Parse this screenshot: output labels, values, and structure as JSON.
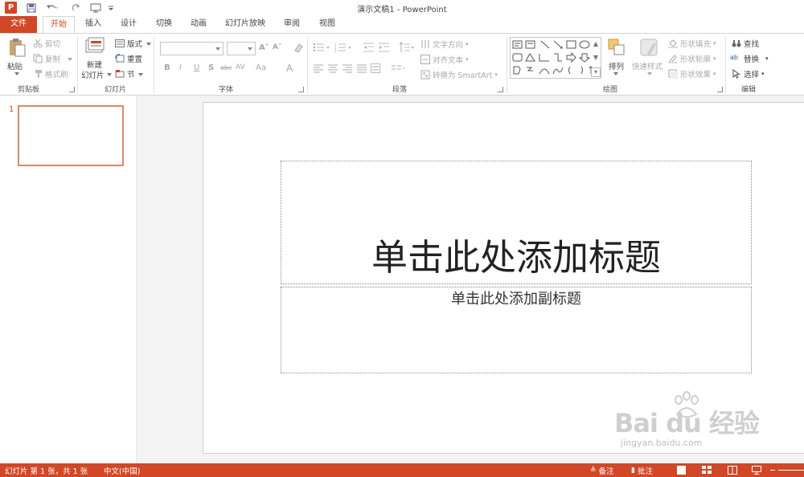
{
  "window": {
    "title": "演示文稿1 - PowerPoint",
    "app_icon_letter": "P"
  },
  "quick_access": {
    "save_icon": "save-icon",
    "undo_icon": "undo-icon",
    "redo_icon": "redo-icon",
    "present_icon": "start-from-beginning-icon",
    "customize_icon": "customize-toolbar-icon"
  },
  "tabs": [
    {
      "label": "文件"
    },
    {
      "label": "开始"
    },
    {
      "label": "插入"
    },
    {
      "label": "设计"
    },
    {
      "label": "切换"
    },
    {
      "label": "动画"
    },
    {
      "label": "幻灯片放映"
    },
    {
      "label": "审阅"
    },
    {
      "label": "视图"
    }
  ],
  "ribbon": {
    "clipboard": {
      "paste": "粘贴",
      "cut": "剪切",
      "copy": "复制",
      "format_painter": "格式刷",
      "group_label": "剪贴板"
    },
    "slides": {
      "new_slide_line1": "新建",
      "new_slide_line2": "幻灯片",
      "layout": "版式",
      "reset": "重置",
      "section": "节",
      "group_label": "幻灯片"
    },
    "font": {
      "font_name_value": "",
      "font_size_value": "",
      "grow": "A˄",
      "shrink": "A˅",
      "clear": "清除格式",
      "bold": "B",
      "italic": "I",
      "underline": "U",
      "shadow": "S",
      "strike": "abc",
      "spacing": "AV",
      "case": "Aa",
      "color": "A",
      "group_label": "字体"
    },
    "paragraph": {
      "text_direction": "文字方向",
      "align_text": "对齐文本",
      "convert_smartart": "转换为 SmartArt",
      "group_label": "段落"
    },
    "drawing": {
      "arrange": "排列",
      "quick_styles": "快速样式",
      "shape_fill": "形状填充",
      "shape_outline": "形状轮廓",
      "shape_effects": "形状效果",
      "group_label": "绘图"
    },
    "editing": {
      "find": "查找",
      "replace": "替换",
      "select": "选择",
      "group_label": "编辑"
    }
  },
  "thumbnail_pane": {
    "slide_number": "1"
  },
  "slide": {
    "title_placeholder": "单击此处添加标题",
    "subtitle_placeholder": "单击此处添加副标题"
  },
  "watermark": {
    "main": "Bai du 经验",
    "sub": "jingyan.baidu.com"
  },
  "statusbar": {
    "slide_info": "幻灯片 第 1 张，共 1 张",
    "language": "中文(中国)",
    "notes": "备注",
    "comments": "批注"
  },
  "colors": {
    "accent": "#d24726",
    "thumb_border": "#d58a6c"
  }
}
